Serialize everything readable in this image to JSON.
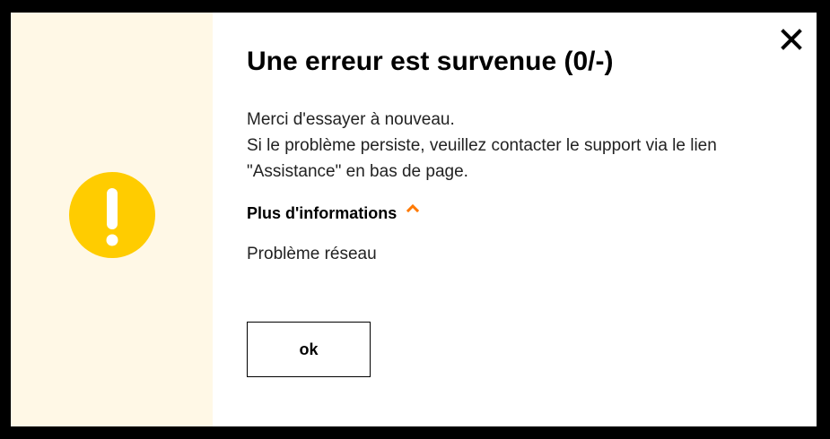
{
  "dialog": {
    "title": "Une erreur est survenue (0/-)",
    "message_lines": [
      "Merci d'essayer à nouveau.",
      "Si le problème persiste, veuillez contacter le support via le lien",
      "\"Assistance\" en bas de page."
    ],
    "more_info_label": "Plus d'informations",
    "details_text": "Problème réseau",
    "ok_label": "ok",
    "icons": {
      "warning": "warning-icon",
      "close": "close-icon",
      "expand": "chevron-up-icon"
    },
    "colors": {
      "icon_panel_bg": "#fff8e6",
      "warning_yellow": "#ffcc00",
      "chevron_orange": "#ff7900"
    }
  }
}
